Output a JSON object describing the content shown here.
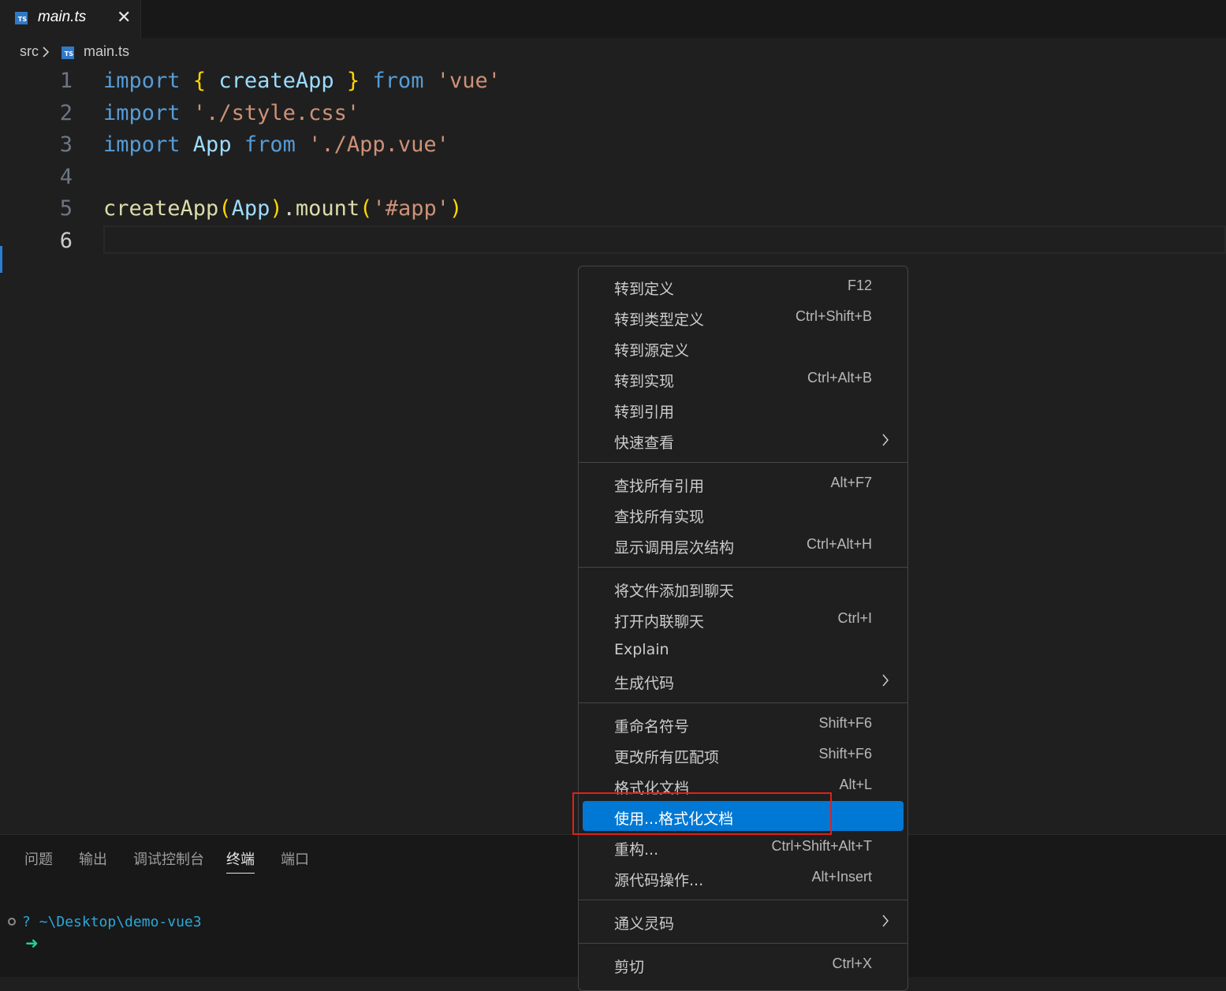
{
  "tab": {
    "label": "main.ts",
    "icon": "ts-file-icon",
    "close": "✕"
  },
  "breadcrumb": {
    "folder": "src",
    "file": "main.ts",
    "icon": "ts-file-icon"
  },
  "editor": {
    "line_numbers": [
      "1",
      "2",
      "3",
      "4",
      "5",
      "6"
    ],
    "line1": {
      "t1": "import",
      "t2": " ",
      "t3": "{",
      "t4": " createApp ",
      "t5": "}",
      "t6": " ",
      "t7": "from",
      "t8": " ",
      "t9": "'vue'"
    },
    "line2": {
      "t1": "import",
      "t2": " ",
      "t3": "'./style.css'"
    },
    "line3": {
      "t1": "import",
      "t2": " App ",
      "t3": "from",
      "t4": " ",
      "t5": "'./App.vue'"
    },
    "line5": {
      "t1": "createApp",
      "t2": "(",
      "t3": "App",
      "t4": ")",
      "t5": ".",
      "t6": "mount",
      "t7": "(",
      "t8": "'#app'",
      "t9": ")"
    }
  },
  "panel": {
    "tabs": [
      "问题",
      "输出",
      "调试控制台",
      "终端",
      "端口"
    ],
    "active_tab": "终端",
    "terminal": {
      "glyph": "?",
      "path": "~\\Desktop\\demo-vue3",
      "prompt": "➜"
    }
  },
  "context_menu": {
    "groups": [
      [
        {
          "label": "转到定义",
          "shortcut": "F12"
        },
        {
          "label": "转到类型定义",
          "shortcut": "Ctrl+Shift+B"
        },
        {
          "label": "转到源定义",
          "shortcut": ""
        },
        {
          "label": "转到实现",
          "shortcut": "Ctrl+Alt+B"
        },
        {
          "label": "转到引用",
          "shortcut": ""
        },
        {
          "label": "快速查看",
          "shortcut": "",
          "submenu": true
        }
      ],
      [
        {
          "label": "查找所有引用",
          "shortcut": "Alt+F7"
        },
        {
          "label": "查找所有实现",
          "shortcut": ""
        },
        {
          "label": "显示调用层次结构",
          "shortcut": "Ctrl+Alt+H"
        }
      ],
      [
        {
          "label": "将文件添加到聊天",
          "shortcut": ""
        },
        {
          "label": "打开内联聊天",
          "shortcut": "Ctrl+I"
        },
        {
          "label": "Explain",
          "shortcut": ""
        },
        {
          "label": "生成代码",
          "shortcut": "",
          "submenu": true
        }
      ],
      [
        {
          "label": "重命名符号",
          "shortcut": "Shift+F6"
        },
        {
          "label": "更改所有匹配项",
          "shortcut": "Shift+F6"
        },
        {
          "label": "格式化文档",
          "shortcut": "Alt+L"
        },
        {
          "label": "使用...格式化文档",
          "shortcut": "",
          "highlighted": true
        },
        {
          "label": "重构...",
          "shortcut": "Ctrl+Shift+Alt+T"
        },
        {
          "label": "源代码操作...",
          "shortcut": "Alt+Insert"
        }
      ],
      [
        {
          "label": "通义灵码",
          "shortcut": "",
          "submenu": true
        }
      ],
      [
        {
          "label": "剪切",
          "shortcut": "Ctrl+X"
        }
      ]
    ]
  },
  "colors": {
    "editor_bg": "#1f1f1f",
    "keyword": "#569cd6",
    "string": "#ce9178",
    "function": "#dcdcaa",
    "variable": "#9cdcfe",
    "bracket": "#ffd700",
    "highlight": "#0078d4",
    "annotation_box": "#e0201b"
  }
}
